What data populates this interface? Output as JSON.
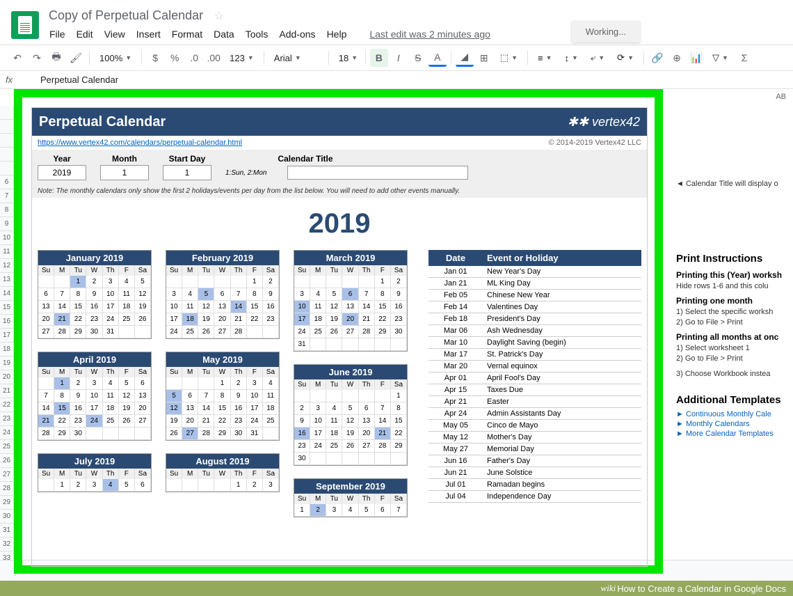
{
  "doc_title": "Copy of Perpetual Calendar",
  "last_edit": "Last edit was 2 minutes ago",
  "working": "Working...",
  "menu": [
    "File",
    "Edit",
    "View",
    "Insert",
    "Format",
    "Data",
    "Tools",
    "Add-ons",
    "Help"
  ],
  "toolbar": {
    "zoom": "100%",
    "font": "Arial",
    "size": "18",
    "fmt123": "123"
  },
  "formula": {
    "fx": "fx",
    "content": "Perpetual Calendar"
  },
  "col_hdr": "AB",
  "cal": {
    "title": "Perpetual Calendar",
    "brand": "✱✱ vertex42",
    "link": "https://www.vertex42.com/calendars/perpetual-calendar.html",
    "copyright": "© 2014-2019 Vertex42 LLC",
    "labels": {
      "year": "Year",
      "month": "Month",
      "start": "Start Day",
      "caltitle": "Calendar Title"
    },
    "inputs": {
      "year": "2019",
      "month": "1",
      "start": "1"
    },
    "hint": "1:Sun, 2:Mon",
    "note": "Note: The monthly calendars only show the first 2 holidays/events per day from the list below. You will need to add other events manually.",
    "year_big": "2019",
    "dow": [
      "Su",
      "M",
      "Tu",
      "W",
      "Th",
      "F",
      "Sa"
    ],
    "months": [
      {
        "name": "January 2019",
        "offset": 2,
        "days": 31,
        "hl": [
          1,
          21
        ]
      },
      {
        "name": "February 2019",
        "offset": 5,
        "days": 28,
        "hl": [
          5,
          14,
          18
        ]
      },
      {
        "name": "March 2019",
        "offset": 5,
        "days": 31,
        "hl": [
          6,
          10,
          17,
          20
        ]
      },
      {
        "name": "April 2019",
        "offset": 1,
        "days": 30,
        "hl": [
          1,
          15,
          21,
          24
        ]
      },
      {
        "name": "May 2019",
        "offset": 3,
        "days": 31,
        "hl": [
          5,
          12,
          27
        ]
      },
      {
        "name": "June 2019",
        "offset": 6,
        "days": 30,
        "hl": [
          16,
          21
        ]
      },
      {
        "name": "July 2019",
        "offset": 1,
        "days": 31,
        "hl": [
          4
        ]
      },
      {
        "name": "August 2019",
        "offset": 4,
        "days": 31,
        "hl": []
      },
      {
        "name": "September 2019",
        "offset": 0,
        "days": 30,
        "hl": [
          2
        ]
      }
    ],
    "events_hdr": {
      "date": "Date",
      "name": "Event or Holiday"
    },
    "events": [
      {
        "d": "Jan 01",
        "n": "New Year's Day"
      },
      {
        "d": "Jan 21",
        "n": "ML King Day"
      },
      {
        "d": "Feb 05",
        "n": "Chinese New Year"
      },
      {
        "d": "Feb 14",
        "n": "Valentines Day"
      },
      {
        "d": "Feb 18",
        "n": "President's Day"
      },
      {
        "d": "Mar 06",
        "n": "Ash Wednesday"
      },
      {
        "d": "Mar 10",
        "n": "Daylight Saving (begin)"
      },
      {
        "d": "Mar 17",
        "n": "St. Patrick's Day"
      },
      {
        "d": "Mar 20",
        "n": "Vernal equinox"
      },
      {
        "d": "Apr 01",
        "n": "April Fool's Day"
      },
      {
        "d": "Apr 15",
        "n": "Taxes Due"
      },
      {
        "d": "Apr 21",
        "n": "Easter"
      },
      {
        "d": "Apr 24",
        "n": "Admin Assistants Day"
      },
      {
        "d": "May 05",
        "n": "Cinco de Mayo"
      },
      {
        "d": "May 12",
        "n": "Mother's Day"
      },
      {
        "d": "May 27",
        "n": "Memorial Day"
      },
      {
        "d": "Jun 16",
        "n": "Father's Day"
      },
      {
        "d": "Jun 21",
        "n": "June Solstice"
      },
      {
        "d": "Jul 01",
        "n": "Ramadan begins"
      },
      {
        "d": "Jul 04",
        "n": "Independence Day"
      }
    ]
  },
  "sidebar": {
    "hint": "◄ Calendar Title will display o",
    "h1": "Print Instructions",
    "s1": "Printing this (Year) worksh",
    "t1": "Hide rows 1-6 and this colu",
    "s2": "Printing one month",
    "t2a": "1) Select the specific worksh",
    "t2b": "2) Go to File > Print",
    "s3": "Printing all months at onc",
    "t3a": "1) Select worksheet 1",
    "t3b": "2) Go to File > Print",
    "t3c": "3) Choose Workbook instea",
    "h2": "Additional Templates",
    "l1": "► Continuous Monthly Cale",
    "l2": "► Monthly Calendars",
    "l3": "► More Calendar Templates"
  },
  "wiki": "How to Create a Calendar in Google Docs"
}
